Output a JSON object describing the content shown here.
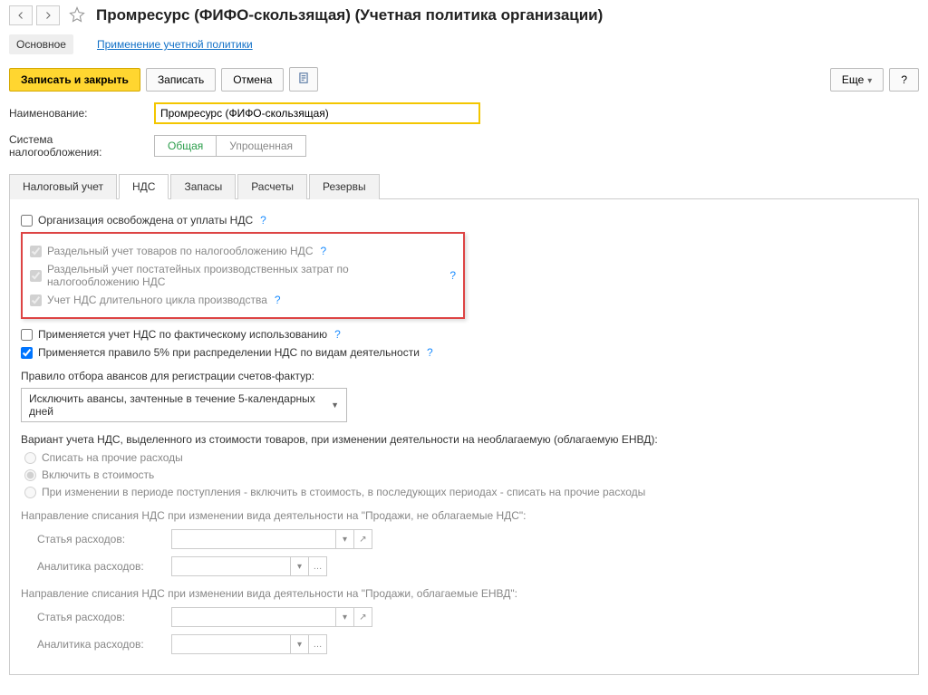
{
  "header": {
    "title": "Промресурс (ФИФО-скользящая) (Учетная политика организации)"
  },
  "section_nav": {
    "main": "Основное",
    "policy_link": "Применение учетной политики"
  },
  "toolbar": {
    "save_close": "Записать и закрыть",
    "save": "Записать",
    "cancel": "Отмена",
    "more": "Еще",
    "help": "?"
  },
  "form": {
    "name_label": "Наименование:",
    "name_value": "Промресурс (ФИФО-скользящая)",
    "tax_system_label": "Система налогообложения:",
    "tax_general": "Общая",
    "tax_simple": "Упрощенная"
  },
  "tabs": {
    "t0": "Налоговый учет",
    "t1": "НДС",
    "t2": "Запасы",
    "t3": "Расчеты",
    "t4": "Резервы"
  },
  "nds": {
    "exempt": "Организация освобождена от уплаты НДС",
    "sep_goods": "Раздельный учет товаров по налогообложению НДС",
    "sep_costs": "Раздельный учет постатейных производственных затрат по налогообложению НДС",
    "long_cycle": "Учет НДС длительного цикла производства",
    "actual_use": "Применяется учет НДС по фактическому использованию",
    "rule5": "Применяется правило 5% при распределении НДС по видам деятельности",
    "advance_rule_label": "Правило отбора авансов для регистрации счетов-фактур:",
    "advance_rule_value": "Исключить авансы, зачтенные в течение 5-календарных дней",
    "variant_label": "Вариант учета НДС, выделенного из стоимости товаров, при изменении деятельности на необлагаемую (облагаемую ЕНВД):",
    "variant_r1": "Списать на прочие расходы",
    "variant_r2": "Включить в стоимость",
    "variant_r3": "При изменении в периоде поступления - включить в стоимость, в последующих периодах - списать на прочие расходы",
    "writeoff1_label": "Направление списания НДС при изменении вида деятельности на \"Продажи, не облагаемые НДС\":",
    "writeoff2_label": "Направление списания НДС при изменении вида деятельности на \"Продажи, облагаемые ЕНВД\":",
    "expense_item": "Статья расходов:",
    "expense_analytics": "Аналитика расходов:",
    "q": "?"
  }
}
